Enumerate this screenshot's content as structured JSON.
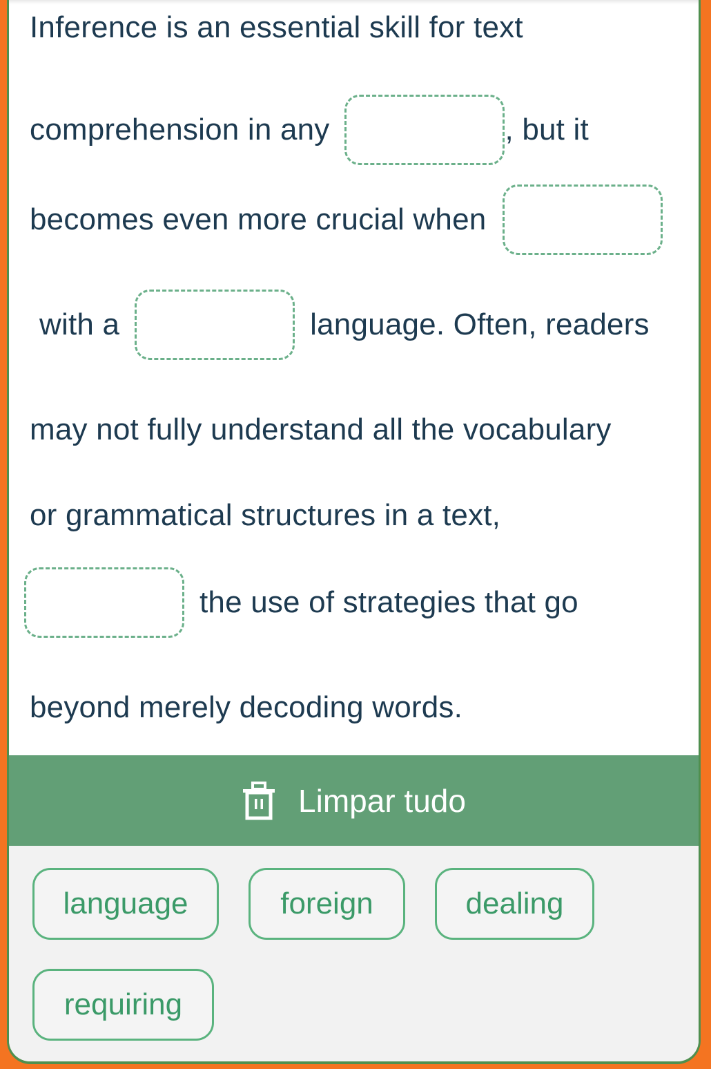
{
  "exercise": {
    "lines": [
      {
        "before": "Inference is an essential skill for text",
        "after": ""
      },
      {
        "before": "comprehension in any",
        "after": ", but it"
      },
      {
        "before": "becomes even more crucial when",
        "after": ""
      },
      {
        "before": "with a",
        "after": "language. Often, readers"
      },
      {
        "before": "may not fully understand all the vocabulary",
        "after": ""
      },
      {
        "before": "or grammatical structures in a text,",
        "after": ""
      },
      {
        "before": "",
        "after": "the use of strategies that go"
      },
      {
        "before": "beyond merely decoding words.",
        "after": ""
      }
    ],
    "blanks": [
      "",
      "",
      "",
      ""
    ]
  },
  "clear_button": {
    "label": "Limpar tudo",
    "icon": "trash-icon"
  },
  "word_bank": [
    {
      "label": "language"
    },
    {
      "label": "foreign"
    },
    {
      "label": "dealing"
    },
    {
      "label": "requiring"
    }
  ],
  "colors": {
    "frame": "#f47421",
    "accent_green": "#629f76",
    "chip_text": "#3b9a68",
    "chip_border": "#5ab37e",
    "text": "#1d3a50"
  }
}
